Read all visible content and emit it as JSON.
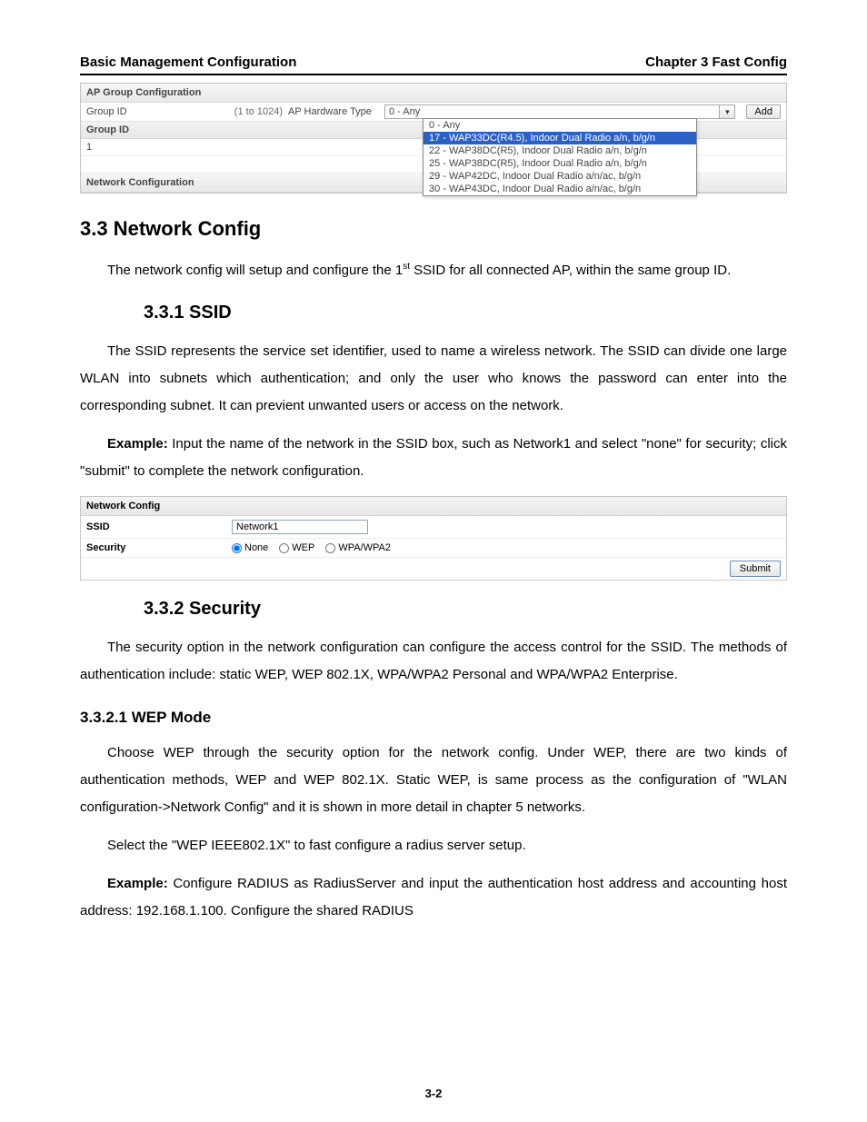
{
  "header": {
    "left": "Basic Management Configuration",
    "right": "Chapter 3 Fast Config"
  },
  "page_number": "3-2",
  "fig1": {
    "title": "AP Group Configuration",
    "group_id_label": "Group ID",
    "group_id_range": "(1 to 1024)",
    "hw_type_label": "AP Hardware Type",
    "hw_type_value": "0 - Any",
    "add_label": "Add",
    "table": {
      "head_group_id": "Group ID",
      "row1_id": "1"
    },
    "menu": {
      "items": [
        "0 - Any",
        "17 - WAP33DC(R4.5), Indoor Dual Radio a/n, b/g/n",
        "22 - WAP38DC(R5), Indoor Dual Radio a/n, b/g/n",
        "25 - WAP38DC(R5), Indoor Dual Radio a/n, b/g/n",
        "29 - WAP42DC, Indoor Dual Radio a/n/ac, b/g/n",
        "30 - WAP43DC, Indoor Dual Radio a/n/ac, b/g/n"
      ],
      "selected_index": 1
    },
    "footer_bar": "Network Configuration"
  },
  "sec_33": {
    "title": "3.3 Network Config",
    "para": "The network config will setup and configure the 1",
    "para_sup": "st",
    "para_after": " SSID for all connected AP, within the same group ID."
  },
  "sec_331": {
    "title": "3.3.1 SSID",
    "para1": "The SSID represents the service set identifier, used to name a wireless network. The SSID can divide one large WLAN into subnets which authentication; and only the user who knows the password can enter into the corresponding subnet. It can previent unwanted users or access on the network.",
    "example_label": "Example:",
    "example_text": " Input the name of the network in the SSID box, such as Network1 and select \"none\" for security; click \"submit\" to complete the network configuration."
  },
  "fig2": {
    "title": "Network Config",
    "ssid_label": "SSID",
    "ssid_value": "Network1",
    "security_label": "Security",
    "security_options": {
      "none": "None",
      "wep": "WEP",
      "wpa": "WPA/WPA2"
    },
    "submit_label": "Submit"
  },
  "sec_332": {
    "title": "3.3.2 Security",
    "para": "The security option in the network configuration can configure the access control for the SSID. The methods of authentication include: static WEP, WEP 802.1X, WPA/WPA2 Personal and WPA/WPA2 Enterprise."
  },
  "sec_3321": {
    "title": "3.3.2.1 WEP Mode",
    "para1": "Choose WEP through the security option for the network config. Under WEP, there are two kinds of authentication methods, WEP and WEP 802.1X. Static WEP, is same process as the configuration of \"WLAN configuration->Network Config\" and it is shown in more detail in chapter 5 networks.",
    "para2": "Select the \"WEP IEEE802.1X\" to fast configure a radius server setup.",
    "example_label": "Example:",
    "para3": " Configure RADIUS as RadiusServer and input the authentication host address and accounting host address: 192.168.1.100. Configure the shared RADIUS"
  }
}
